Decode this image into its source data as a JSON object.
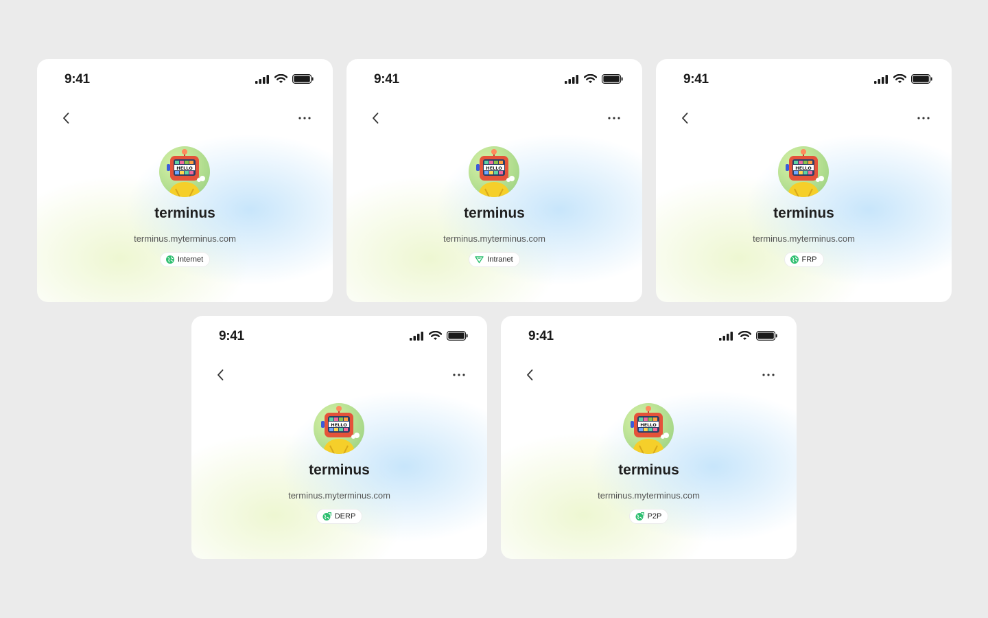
{
  "cards": [
    {
      "time": "9:41",
      "name": "terminus",
      "domain": "terminus.myterminus.com",
      "badge": "Internet",
      "badge_icon": "globe-icon"
    },
    {
      "time": "9:41",
      "name": "terminus",
      "domain": "terminus.myterminus.com",
      "badge": "Intranet",
      "badge_icon": "shield-icon"
    },
    {
      "time": "9:41",
      "name": "terminus",
      "domain": "terminus.myterminus.com",
      "badge": "FRP",
      "badge_icon": "globe-icon"
    },
    {
      "time": "9:41",
      "name": "terminus",
      "domain": "terminus.myterminus.com",
      "badge": "DERP",
      "badge_icon": "globe-relay-icon"
    },
    {
      "time": "9:41",
      "name": "terminus",
      "domain": "terminus.myterminus.com",
      "badge": "P2P",
      "badge_icon": "globe-relay-icon"
    }
  ],
  "avatar_text": "HELLO",
  "colors": {
    "background": "#ebebeb",
    "badge_green": "#2fbf71",
    "text": "#1f1f1f"
  }
}
